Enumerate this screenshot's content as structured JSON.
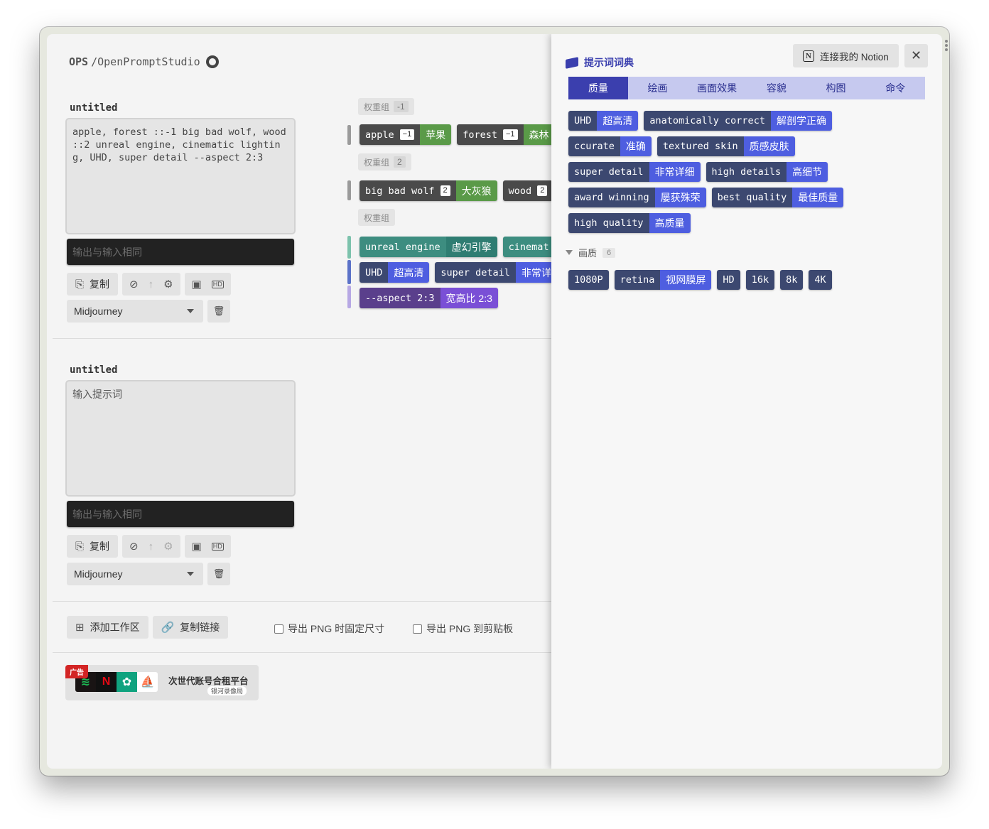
{
  "brand": {
    "prefix": "OPS",
    "name": "/OpenPromptStudio"
  },
  "workspaces": [
    {
      "title": "untitled",
      "prompt": "apple, forest ::-1 big bad wolf, wood ::2 unreal engine, cinematic lighting, UHD, super detail --aspect 2:3",
      "output_placeholder": "输出与输入相同",
      "copy_label": "复制",
      "model": "Midjourney"
    },
    {
      "title": "untitled",
      "prompt_placeholder": "输入提示词",
      "output_placeholder": "输出与输入相同",
      "copy_label": "复制",
      "model": "Midjourney"
    }
  ],
  "tag_groups": [
    {
      "label": "权重组",
      "weight": "-1",
      "tags": [
        {
          "en": "apple",
          "weight": "−1",
          "zh": "苹果"
        },
        {
          "en": "forest",
          "weight": "−1",
          "zh": "森林"
        }
      ]
    },
    {
      "label": "权重组",
      "weight": "2",
      "tags": [
        {
          "en": "big bad wolf",
          "weight": "2",
          "zh": "大灰狼"
        },
        {
          "en": "wood",
          "weight": "2",
          "zh": ""
        }
      ]
    },
    {
      "label": "权重组",
      "rows": [
        [
          {
            "en": "unreal engine",
            "zh": "虚幻引擎"
          },
          {
            "en": "cinemat",
            "zh": ""
          }
        ],
        [
          {
            "en": "UHD",
            "zh": "超高清"
          },
          {
            "en": "super detail",
            "zh": "非常详"
          }
        ],
        [
          {
            "en": "--aspect 2:3",
            "zh": "宽高比 2:3"
          }
        ]
      ]
    }
  ],
  "footer": {
    "add_workspace": "添加工作区",
    "copy_link": "复制链接",
    "export_fixed": "导出 PNG 时固定尺寸",
    "export_clipboard": "导出 PNG 到剪贴板"
  },
  "ad": {
    "badge": "广告",
    "title": "次世代账号合租平台",
    "subtitle": "银河录像局"
  },
  "dictionary": {
    "title": "提示词词典",
    "notion_button": "连接我的 Notion",
    "tabs": [
      "质量",
      "绘画",
      "画面效果",
      "容貌",
      "构图",
      "命令"
    ],
    "active_tab": "质量",
    "quality_rows": [
      [
        {
          "en": "UHD",
          "zh": "超高清"
        },
        {
          "en": "anatomically correct",
          "zh": "解剖学正确"
        }
      ],
      [
        {
          "en": "ccurate",
          "zh": "准确"
        },
        {
          "en": "textured skin",
          "zh": "质感皮肤"
        }
      ],
      [
        {
          "en": "super detail",
          "zh": "非常详细"
        },
        {
          "en": "high details",
          "zh": "高细节"
        }
      ],
      [
        {
          "en": "award winning",
          "zh": "屡获殊荣"
        },
        {
          "en": "best quality",
          "zh": "最佳质量"
        }
      ],
      [
        {
          "en": "high quality",
          "zh": "高质量"
        }
      ]
    ],
    "section": {
      "name": "画质",
      "count": "6"
    },
    "resolution_tags": [
      {
        "en": "1080P",
        "zh": ""
      },
      {
        "en": "retina",
        "zh": "视网膜屏"
      },
      {
        "en": "HD",
        "zh": ""
      },
      {
        "en": "16k",
        "zh": ""
      },
      {
        "en": "8k",
        "zh": ""
      },
      {
        "en": "4K",
        "zh": ""
      }
    ]
  },
  "colors": {
    "accent": "#3b3fae",
    "tab_bg": "#c6c9ef",
    "tag_en": "#4a4a4a",
    "green": "#5a9a48",
    "teal": "#3d8d80",
    "blue": "#4e5ee0",
    "purple": "#7a4fd6",
    "ad_red": "#d32525"
  }
}
